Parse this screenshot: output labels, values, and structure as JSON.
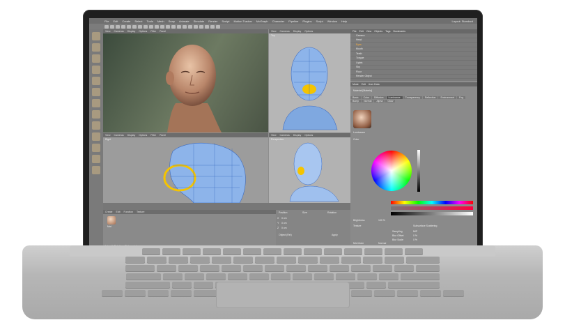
{
  "app": {
    "menu": [
      "File",
      "Edit",
      "Create",
      "Select",
      "Tools",
      "Mesh",
      "Snap",
      "Animate",
      "Simulate",
      "Render",
      "Sculpt",
      "Motion Tracker",
      "MoGraph",
      "Character",
      "Pipeline",
      "Plugins",
      "Script",
      "Window",
      "Help"
    ],
    "layout_label": "Layout: Standard"
  },
  "viewports": {
    "perspective": {
      "menu": [
        "View",
        "Cameras",
        "Display",
        "Options",
        "Filter",
        "Panel"
      ],
      "label": "Perspective"
    },
    "top": {
      "menu": [
        "View",
        "Cameras",
        "Display",
        "Options",
        "Filter",
        "Panel"
      ],
      "label": "Top"
    },
    "right": {
      "menu": [
        "View",
        "Cameras",
        "Display",
        "Options",
        "Filter",
        "Panel"
      ],
      "label": "Right"
    },
    "front": {
      "menu": [
        "View",
        "Cameras",
        "Display",
        "Options",
        "Filter",
        "Panel"
      ],
      "label": "Perspective"
    }
  },
  "object_manager": {
    "menu": [
      "File",
      "Edit",
      "View",
      "Objects",
      "Tags",
      "Bookmarks"
    ],
    "items": [
      "Camera",
      "Head",
      "Eyes",
      "Mouth",
      "Teeth",
      "Tongue",
      "Lights",
      "Sky",
      "Floor",
      "Render Object"
    ]
  },
  "attributes": {
    "menu": [
      "Mode",
      "Edit",
      "User Data"
    ],
    "material_name": "Material [Materia]",
    "tabs": [
      "Basic",
      "Color",
      "Diffusion",
      "Luminance",
      "Transparency",
      "Reflection",
      "Environment",
      "Fog",
      "Bump",
      "Normal",
      "Alpha",
      "Glow"
    ],
    "active_tab": "Luminance",
    "section": "Luminance",
    "color_label": "Color",
    "brightness_label": "Brightness",
    "brightness_value": "100 %",
    "texture_label": "Texture",
    "mix_mode_label": "Mix Mode",
    "mix_mode_value": "Normal",
    "mix_strength_label": "Mix Strength",
    "mix_strength_value": "100 %",
    "sampling_label": "Sampling",
    "sampling_value": "MIP",
    "blur_offset_label": "Blur Offset",
    "blur_offset_value": "0 %",
    "blur_scale_label": "Blur Scale",
    "blur_scale_value": "0 %",
    "shader_label": "Subsurface Scattering"
  },
  "coordinates": {
    "position": "Position",
    "size": "Size",
    "rotation": "Rotation",
    "x": "X",
    "y": "Y",
    "z": "Z",
    "x_val": "0 cm",
    "y_val": "0 cm",
    "z_val": "0 cm",
    "object_rel": "Object (Rel)",
    "apply": "Apply"
  },
  "material_manager": {
    "menu": [
      "Create",
      "Edit",
      "Function",
      "Texture"
    ],
    "material_name": "Mat"
  },
  "status": {
    "text": "Azimuth Rotation: Click and drag"
  }
}
